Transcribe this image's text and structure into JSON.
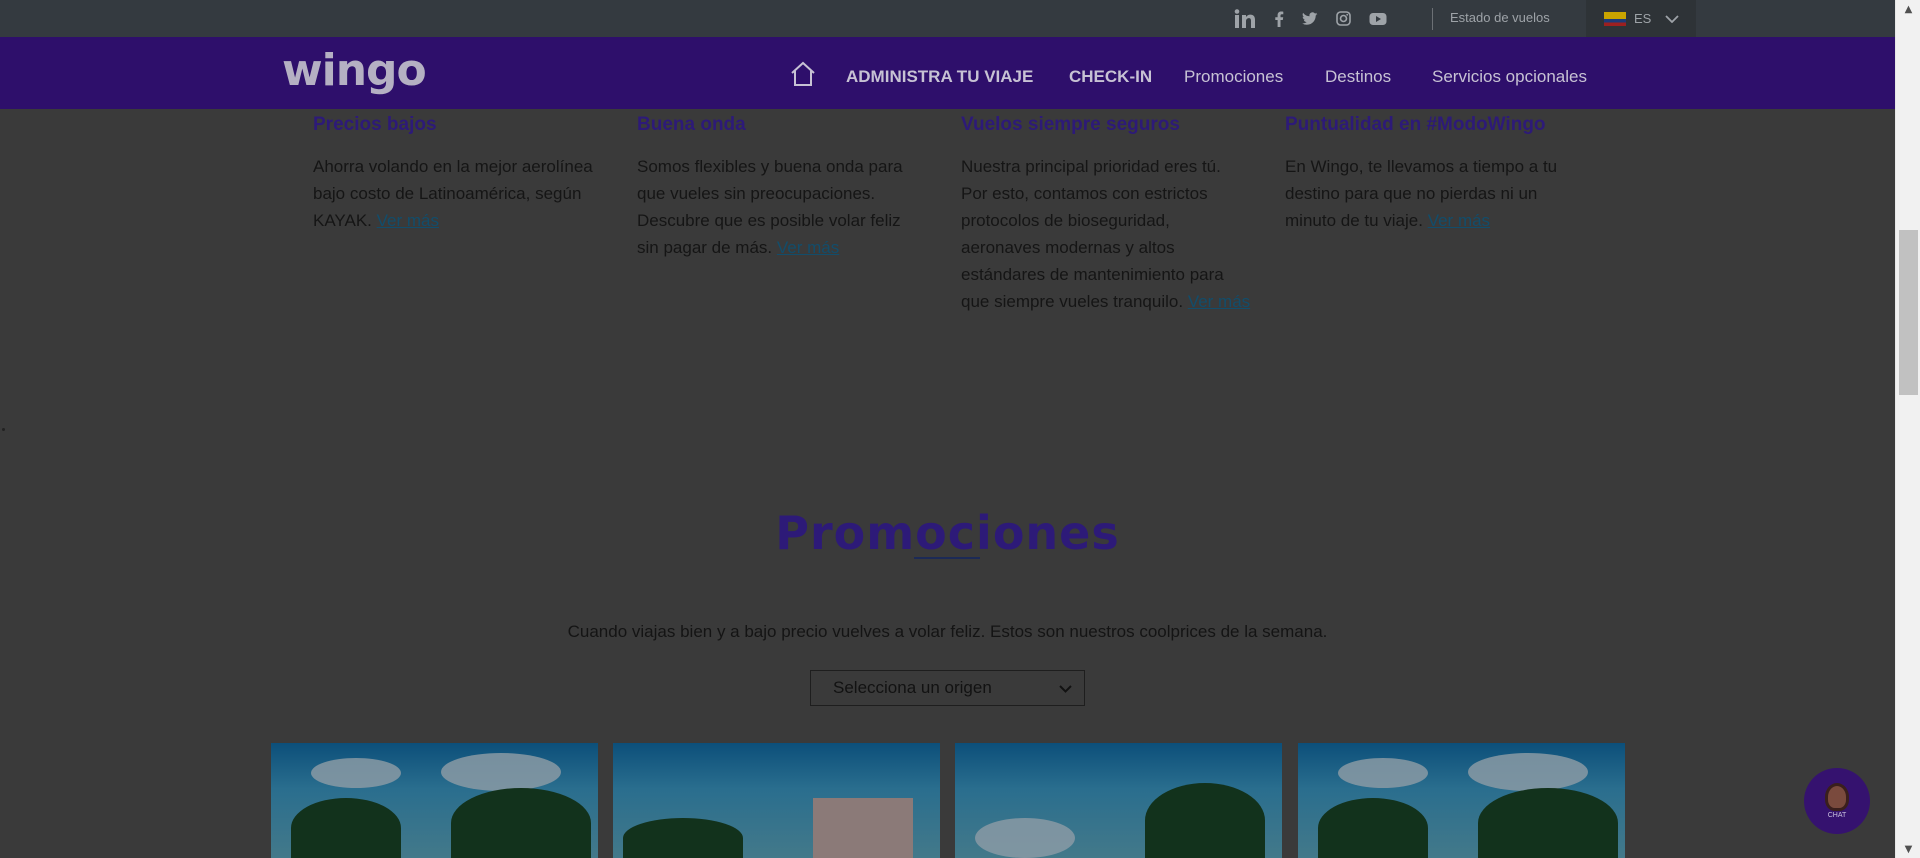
{
  "topbar": {
    "social_icons": [
      "linkedin-icon",
      "facebook-icon",
      "twitter-icon",
      "instagram-icon",
      "youtube-icon"
    ],
    "flight_status_label": "Estado de vuelos",
    "language": {
      "code": "ES",
      "flag": "colombia-flag-icon"
    }
  },
  "header": {
    "logo_text": "wingo",
    "nav": {
      "home_icon": "home-icon",
      "items": [
        {
          "label": "ADMINISTRA TU VIAJE"
        },
        {
          "label": "CHECK-IN"
        },
        {
          "label": "Promociones"
        },
        {
          "label": "Destinos"
        },
        {
          "label": "Servicios opcionales"
        }
      ]
    }
  },
  "features": [
    {
      "title": "Precios bajos",
      "text": "Ahorra volando en la mejor aerolínea bajo costo de Latinoamérica, según KAYAK.",
      "link": "Ver más"
    },
    {
      "title": "Buena onda",
      "text": "Somos flexibles y buena onda para que vueles sin preocupaciones. Descubre que es posible volar feliz sin pagar de más.",
      "link": "Ver más"
    },
    {
      "title": "Vuelos siempre seguros",
      "text": "Nuestra principal prioridad eres tú. Por esto, contamos con estrictos protocolos de bioseguridad, aeronaves modernas y altos estándares de mantenimiento para que siempre vueles tranquilo.",
      "link": "Ver más"
    },
    {
      "title": "Puntualidad en #ModoWingo",
      "text": "En Wingo, te llevamos a tiempo a tu destino para que no pierdas ni un minuto de tu viaje.",
      "link": "Ver más"
    }
  ],
  "promotions": {
    "title": "Promociones",
    "subtitle": "Cuando viajas bien y a bajo precio vuelves a volar feliz. Estos son nuestros coolprices de la semana.",
    "origin_select": {
      "selected": "Selecciona un origen"
    }
  },
  "chat": {
    "label": "CHAT"
  },
  "colors": {
    "header_bg": "#2e0f6b",
    "topbar_bg": "#343a40",
    "accent_title": "#2d1a78",
    "overlay": "#3a3a3a"
  }
}
